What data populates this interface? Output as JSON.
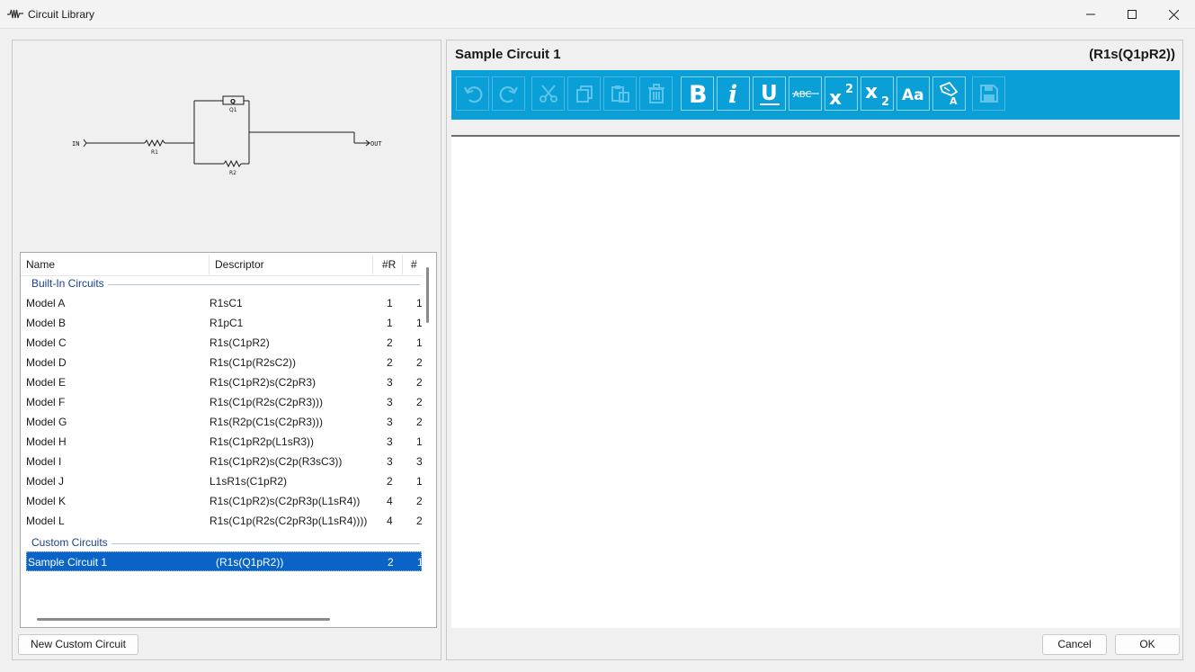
{
  "window": {
    "title": "Circuit Library",
    "app_icon": "waveform-icon"
  },
  "diagram": {
    "in_label": "IN",
    "out_label": "OUT",
    "r1_label": "R1",
    "r2_label": "R2",
    "q1_label": "Q1",
    "q_box": "Q"
  },
  "list": {
    "columns": [
      "Name",
      "Descriptor",
      "#R",
      "#"
    ],
    "groups": [
      {
        "title": "Built-In Circuits",
        "rows": [
          {
            "name": "Model A",
            "descriptor": "R1sC1",
            "r": "1",
            "x": "1"
          },
          {
            "name": "Model B",
            "descriptor": "R1pC1",
            "r": "1",
            "x": "1"
          },
          {
            "name": "Model C",
            "descriptor": "R1s(C1pR2)",
            "r": "2",
            "x": "1"
          },
          {
            "name": "Model D",
            "descriptor": "R1s(C1p(R2sC2))",
            "r": "2",
            "x": "2"
          },
          {
            "name": "Model E",
            "descriptor": "R1s(C1pR2)s(C2pR3)",
            "r": "3",
            "x": "2"
          },
          {
            "name": "Model F",
            "descriptor": "R1s(C1p(R2s(C2pR3)))",
            "r": "3",
            "x": "2"
          },
          {
            "name": "Model G",
            "descriptor": "R1s(R2p(C1s(C2pR3)))",
            "r": "3",
            "x": "2"
          },
          {
            "name": "Model H",
            "descriptor": "R1s(C1pR2p(L1sR3))",
            "r": "3",
            "x": "1"
          },
          {
            "name": "Model I",
            "descriptor": "R1s(C1pR2)s(C2p(R3sC3))",
            "r": "3",
            "x": "3"
          },
          {
            "name": "Model J",
            "descriptor": "L1sR1s(C1pR2)",
            "r": "2",
            "x": "1"
          },
          {
            "name": "Model K",
            "descriptor": "R1s(C1pR2)s(C2pR3p(L1sR4))",
            "r": "4",
            "x": "2"
          },
          {
            "name": "Model L",
            "descriptor": "R1s(C1p(R2s(C2pR3p(L1sR4))))",
            "r": "4",
            "x": "2"
          }
        ]
      },
      {
        "title": "Custom Circuits",
        "rows": [
          {
            "name": "Sample Circuit 1",
            "descriptor": "(R1s(Q1pR2))",
            "r": "2",
            "x": "1",
            "selected": true
          }
        ]
      }
    ]
  },
  "buttons": {
    "new_custom": "New Custom Circuit",
    "cancel": "Cancel",
    "ok": "OK"
  },
  "detail": {
    "title": "Sample Circuit 1",
    "descriptor": "(R1s(Q1pR2))"
  },
  "toolbar": {
    "items": [
      "undo-icon",
      "redo-icon",
      "cut-icon",
      "copy-icon",
      "paste-icon",
      "delete-icon",
      "bold-icon",
      "italic-icon",
      "underline-icon",
      "strikethrough-icon",
      "superscript-icon",
      "subscript-icon",
      "font-size-icon",
      "clear-format-icon",
      "save-icon"
    ],
    "strikethrough_text": "ABC",
    "font_text": "Aa",
    "accent": "#0a9fd6"
  },
  "colors": {
    "selection": "#0a64c8",
    "group_header": "#1a3f8f"
  }
}
